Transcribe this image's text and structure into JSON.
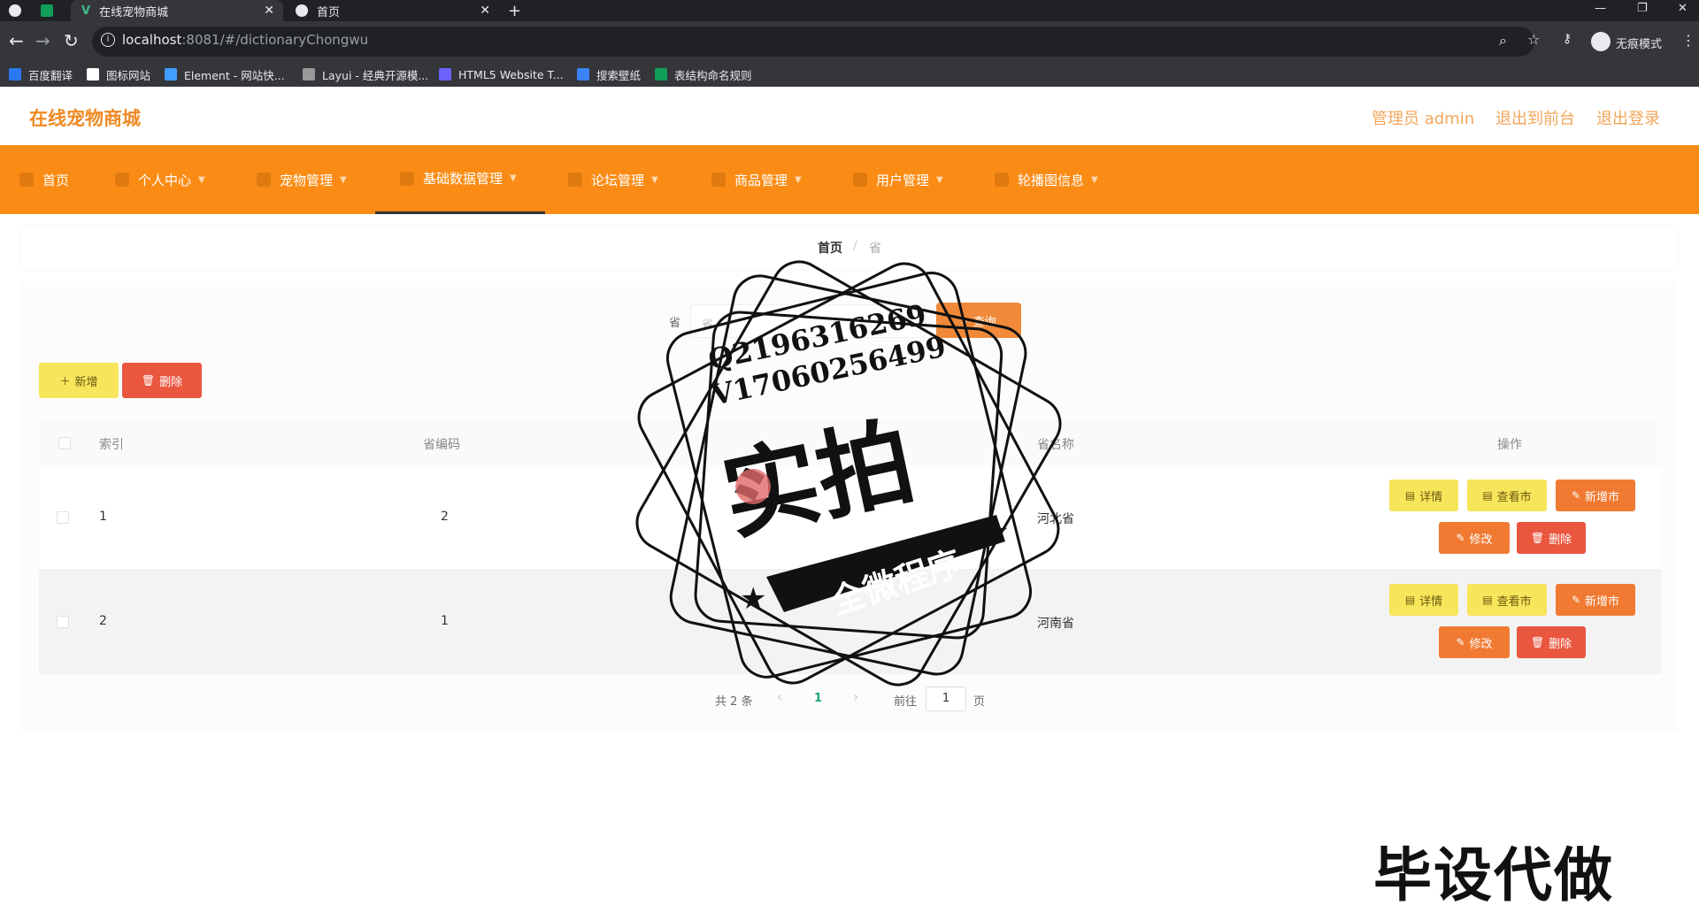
{
  "browser": {
    "tabs": [
      {
        "title": ""
      },
      {
        "title": ""
      },
      {
        "title": "在线宠物商城"
      },
      {
        "title": "首页"
      }
    ],
    "new_tab": "+",
    "url_host": "localhost",
    "url_path": ":8081/#/dictionaryChongwu",
    "incognito_label": "无痕模式",
    "bookmarks": [
      "百度翻译",
      "图标网站",
      "Element - 网站快...",
      "Layui - 经典开源模...",
      "HTML5 Website T...",
      "搜索壁纸",
      "表结构命名规则"
    ]
  },
  "header": {
    "brand": "在线宠物商城",
    "admin": "管理员 admin",
    "to_front": "退出到前台",
    "logout": "退出登录"
  },
  "menu": [
    {
      "label": "首页"
    },
    {
      "label": "个人中心"
    },
    {
      "label": "宠物管理"
    },
    {
      "label": "基础数据管理"
    },
    {
      "label": "论坛管理"
    },
    {
      "label": "商品管理"
    },
    {
      "label": "用户管理"
    },
    {
      "label": "轮播图信息"
    }
  ],
  "breadcrumb": {
    "home": "首页",
    "sep": "/",
    "current": "省"
  },
  "search": {
    "label": "省",
    "placeholder": "省",
    "query_btn": "查询"
  },
  "actions": {
    "add": "新增",
    "delete": "删除"
  },
  "table": {
    "headers": {
      "index": "索引",
      "code": "省编码",
      "name": "省名称",
      "ops": "操作"
    },
    "rows": [
      {
        "index": "1",
        "code": "2",
        "name": "河北省"
      },
      {
        "index": "2",
        "code": "1",
        "name": "河南省"
      }
    ],
    "row_buttons": {
      "detail": "详情",
      "view_city": "查看市",
      "add_city": "新增市",
      "edit": "修改",
      "delete": "删除"
    }
  },
  "pagination": {
    "total": "共 2 条",
    "prev": "‹",
    "current": "1",
    "next": "›",
    "goto": "前往",
    "page_value": "1",
    "page_suffix": "页"
  },
  "overlay": {
    "line1": "Q2196316269",
    "line2": "V17060256499",
    "big": "实拍",
    "ribbon": "全微程序",
    "corner": "毕设代做"
  },
  "colors": {
    "menu_bg": "#fa8c16",
    "brand": "#f08a24",
    "yellow_btn": "#f7e55b",
    "red_btn": "#e9573f",
    "orange_btn": "#f07a32"
  }
}
